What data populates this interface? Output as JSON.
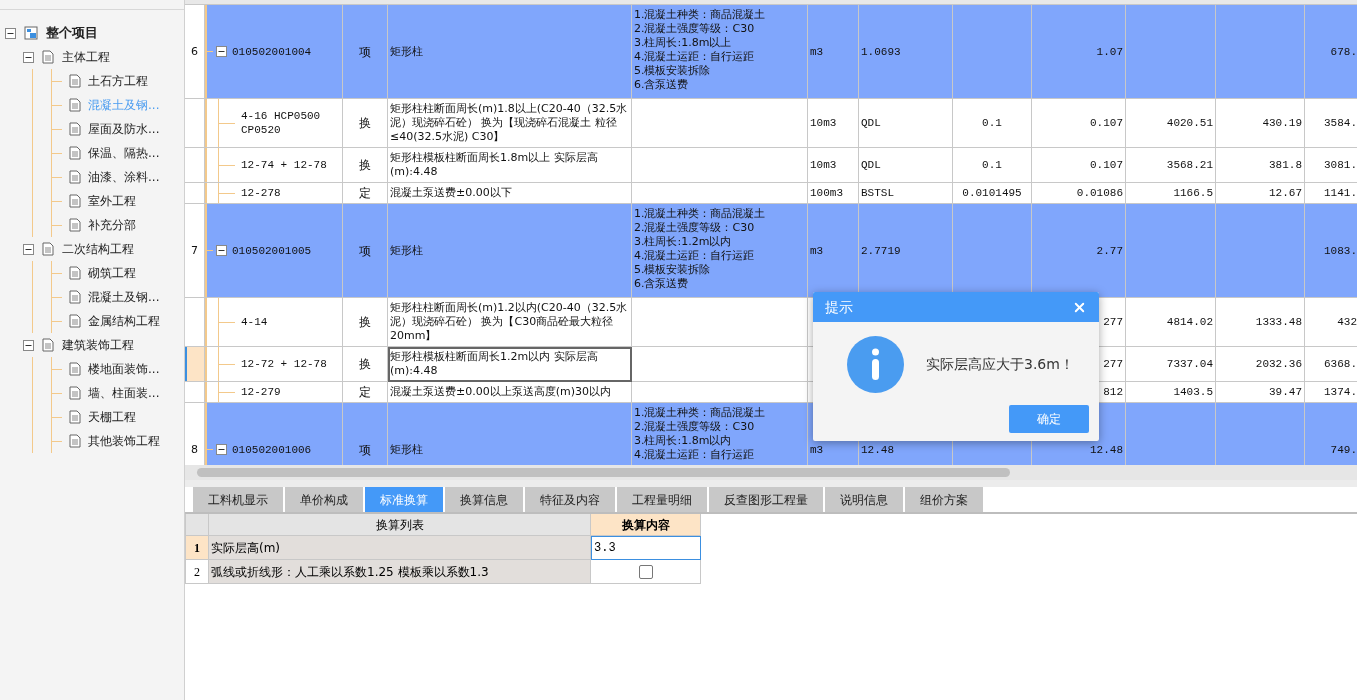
{
  "tree": [
    {
      "label": "整个项目",
      "expanded": true,
      "selected": false,
      "children": [
        {
          "label": "主体工程",
          "expanded": true,
          "selected": false,
          "children": [
            {
              "label": "土石方工程",
              "selected": false
            },
            {
              "label": "混凝土及钢...",
              "selected": true
            },
            {
              "label": "屋面及防水...",
              "selected": false
            },
            {
              "label": "保温、隔热...",
              "selected": false
            },
            {
              "label": "油漆、涂料...",
              "selected": false
            },
            {
              "label": "室外工程",
              "selected": false
            },
            {
              "label": "补充分部",
              "selected": false
            }
          ]
        },
        {
          "label": "二次结构工程",
          "expanded": true,
          "selected": false,
          "children": [
            {
              "label": "砌筑工程",
              "selected": false
            },
            {
              "label": "混凝土及钢...",
              "selected": false
            },
            {
              "label": "金属结构工程",
              "selected": false
            }
          ]
        },
        {
          "label": "建筑装饰工程",
          "expanded": true,
          "selected": false,
          "children": [
            {
              "label": "楼地面装饰...",
              "selected": false
            },
            {
              "label": "墙、柱面装...",
              "selected": false
            },
            {
              "label": "天棚工程",
              "selected": false
            },
            {
              "label": "其他装饰工程",
              "selected": false
            }
          ]
        }
      ]
    }
  ],
  "grid": {
    "rows": [
      {
        "kind": "item",
        "row_no": "6",
        "expanded": true,
        "selected": false,
        "code": "010502001004",
        "type": "项",
        "name": "矩形柱",
        "features": [
          "1.混凝土种类：商品混凝土",
          "2.混凝土强度等级：C30",
          "3.柱周长:1.8m以上",
          "4.混凝土运距：自行运距",
          "5.模板安装拆除",
          "6.含泵送费"
        ],
        "unit": "m3",
        "expr": "1.0693",
        "content": "",
        "qty": "1.07",
        "price1": "",
        "price2": "",
        "price3": "678."
      },
      {
        "kind": "sub",
        "selected": false,
        "code": "4-16 HCP0500 CP0520",
        "type": "换",
        "name": "矩形柱柱断面周长(m)1.8以上(C20-40（32.5水泥）现浇碎石砼） 换为【现浇碎石混凝土 粒径≤40(32.5水泥) C30】",
        "unit": "10m3",
        "expr": "QDL",
        "content": "0.1",
        "qty": "0.107",
        "price1": "4020.51",
        "price2": "430.19",
        "price3": "3584."
      },
      {
        "kind": "sub",
        "selected": false,
        "code": "12-74 + 12-78",
        "type": "换",
        "name": "矩形柱模板柱断面周长1.8m以上  实际层高(m):4.48",
        "unit": "10m3",
        "expr": "QDL",
        "content": "0.1",
        "qty": "0.107",
        "price1": "3568.21",
        "price2": "381.8",
        "price3": "3081."
      },
      {
        "kind": "sub",
        "selected": false,
        "code": "12-278",
        "type": "定",
        "name": "混凝土泵送费±0.00以下",
        "unit": "100m3",
        "expr": "BSTSL",
        "content": "0.0101495",
        "qty": "0.01086",
        "price1": "1166.5",
        "price2": "12.67",
        "price3": "1141."
      },
      {
        "kind": "item",
        "row_no": "7",
        "expanded": true,
        "selected": false,
        "code": "010502001005",
        "type": "项",
        "name": "矩形柱",
        "features": [
          "1.混凝土种类：商品混凝土",
          "2.混凝土强度等级：C30",
          "3.柱周长:1.2m以内",
          "4.混凝土运距：自行运距",
          "5.模板安装拆除",
          "6.含泵送费"
        ],
        "unit": "m3",
        "expr": "2.7719",
        "content": "",
        "qty": "2.77",
        "price1": "",
        "price2": "",
        "price3": "1083."
      },
      {
        "kind": "sub",
        "selected": false,
        "code": "4-14",
        "type": "换",
        "name": "矩形柱柱断面周长(m)1.2以内(C20-40（32.5水泥）现浇碎石砼） 换为【C30商品砼最大粒径20mm】",
        "unit": "",
        "expr": "",
        "content": "",
        "qty": "277",
        "price1": "4814.02",
        "price2": "1333.48",
        "price3": "432"
      },
      {
        "kind": "sub",
        "selected": true,
        "code": "12-72 + 12-78",
        "type": "换",
        "name": "矩形柱模板柱断面周长1.2m以内  实际层高(m):4.48",
        "unit": "",
        "expr": "",
        "content": "",
        "qty": "277",
        "price1": "7337.04",
        "price2": "2032.36",
        "price3": "6368."
      },
      {
        "kind": "sub",
        "selected": false,
        "code": "12-279",
        "type": "定",
        "name": "混凝土泵送费±0.00以上泵送高度(m)30以内",
        "unit": "",
        "expr": "",
        "content": "",
        "qty": "812",
        "price1": "1403.5",
        "price2": "39.47",
        "price3": "1374."
      },
      {
        "kind": "item",
        "row_no": "8",
        "expanded": true,
        "selected": false,
        "code": "010502001006",
        "type": "项",
        "name": "矩形柱",
        "features": [
          "1.混凝土种类：商品混凝土",
          "2.混凝土强度等级：C30",
          "3.柱周长:1.8m以内",
          "4.混凝土运距：自行运距"
        ],
        "unit": "m3",
        "expr": "12.48",
        "content": "",
        "qty": "12.48",
        "price1": "",
        "price2": "",
        "price3": "749."
      }
    ]
  },
  "tabs": [
    {
      "label": "工料机显示",
      "selected": false
    },
    {
      "label": "单价构成",
      "selected": false
    },
    {
      "label": "标准换算",
      "selected": true
    },
    {
      "label": "换算信息",
      "selected": false
    },
    {
      "label": "特征及内容",
      "selected": false
    },
    {
      "label": "工程量明细",
      "selected": false
    },
    {
      "label": "反查图形工程量",
      "selected": false
    },
    {
      "label": "说明信息",
      "selected": false
    },
    {
      "label": "组价方案",
      "selected": false
    }
  ],
  "conversion": {
    "columns": [
      "换算列表",
      "换算内容"
    ],
    "rows": [
      {
        "kind": "input",
        "row_no": "1",
        "label": "实际层高(m)",
        "value": "3.3",
        "selected": true
      },
      {
        "kind": "checkbox",
        "row_no": "2",
        "label": "弧线或折线形：人工乘以系数1.25 模板乘以系数1.3",
        "checked": false,
        "selected": false
      }
    ]
  },
  "dialog": {
    "title": "提示",
    "message": "实际层高应大于3.6m！",
    "button": "确定"
  }
}
